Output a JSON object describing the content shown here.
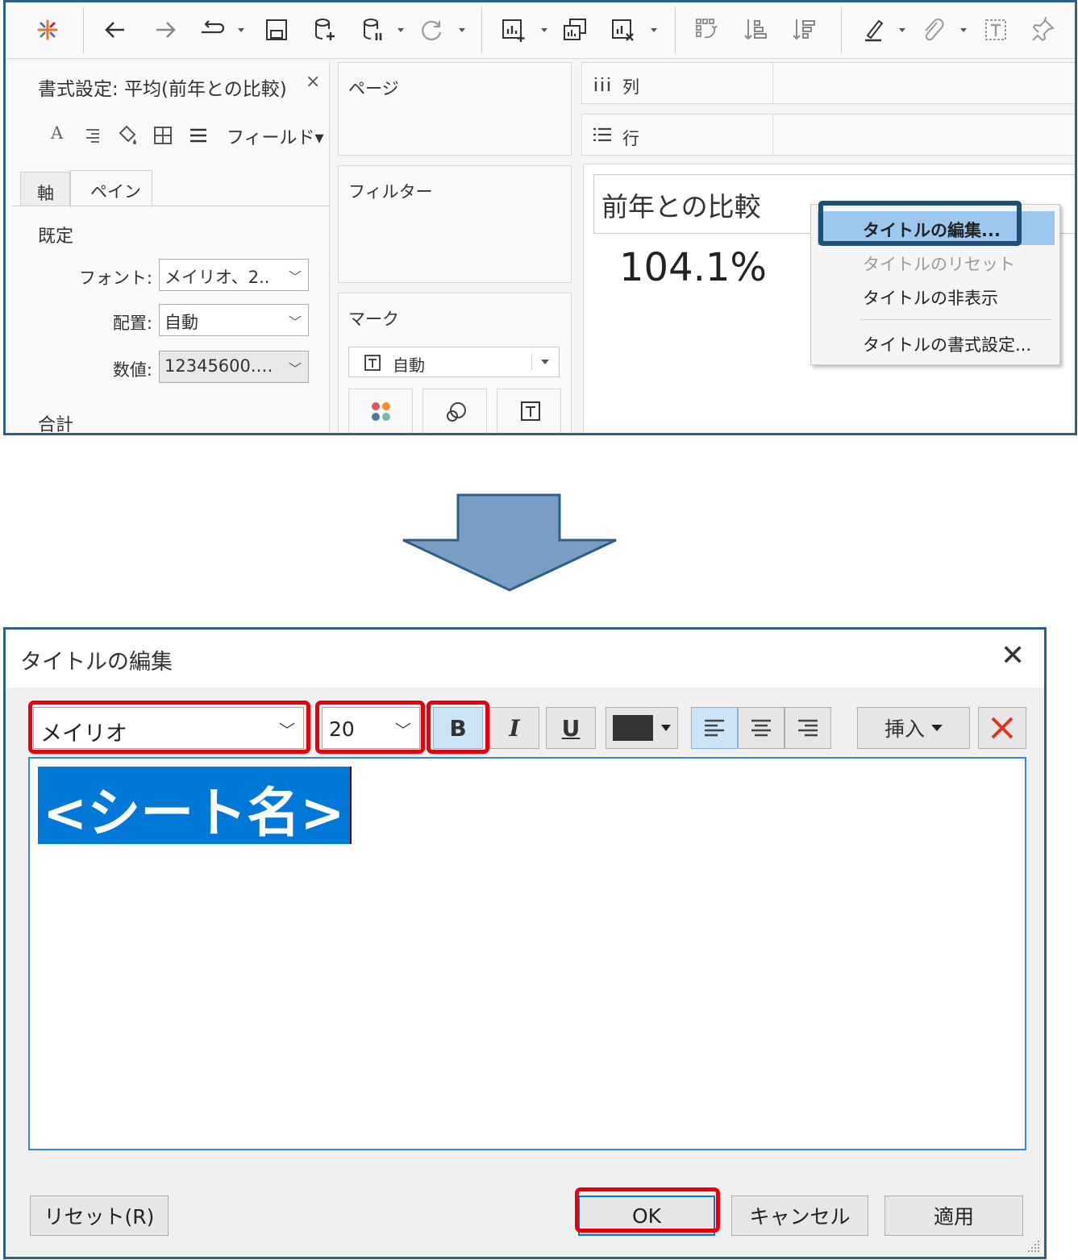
{
  "top": {
    "format_panel": {
      "title": "書式設定: 平均(前年との比較)",
      "close_glyph": "×",
      "field_menu": "フィールド▾",
      "tabs": [
        "軸",
        "ペイン"
      ],
      "section_default": "既定",
      "rows": [
        {
          "label": "フォント:",
          "value": "メイリオ、2.."
        },
        {
          "label": "配置:",
          "value": "自動"
        },
        {
          "label": "数値:",
          "value": "12345600.…"
        }
      ],
      "section_total": "合計"
    },
    "shelves": {
      "pages": "ページ",
      "filters": "フィルター",
      "marks": "マーク",
      "marks_type": "自動",
      "columns": "列",
      "rows": "行"
    },
    "sheet": {
      "title": "前年との比較",
      "value": "104.1%"
    },
    "context_menu": {
      "items": [
        {
          "label": "タイトルの編集...",
          "enabled": true
        },
        {
          "label": "タイトルのリセット",
          "enabled": false
        },
        {
          "label": "タイトルの非表示",
          "enabled": true
        },
        {
          "label": "タイトルの書式設定...",
          "enabled": true
        }
      ]
    },
    "icons": [
      "tableau-logo-icon",
      "undo-icon",
      "redo-icon",
      "replay-icon",
      "save-icon",
      "new-datasource-icon",
      "pause-datasource-icon",
      "refresh-icon",
      "new-worksheet-icon",
      "duplicate-icon",
      "clear-sheet-icon",
      "swap-icon",
      "sort-asc-icon",
      "sort-desc-icon",
      "highlight-icon",
      "paperclip-icon",
      "label-icon",
      "pin-icon"
    ]
  },
  "dialog": {
    "title": "タイトルの編集",
    "close_glyph": "✕",
    "font": "メイリオ",
    "size": "20",
    "bold": "B",
    "italic": "I",
    "underline": "U",
    "insert": "挿入",
    "content": "<シート名>",
    "buttons": {
      "reset": "リセット(R)",
      "ok": "OK",
      "cancel": "キャンセル",
      "apply": "適用"
    }
  },
  "colors": {
    "frame": "#2e5f8a",
    "highlight_red": "#e8000a",
    "highlight_blue": "#1f4e79",
    "selection": "#0078d7",
    "arrow": "#7a9dc4",
    "menu_hover": "#9cc8ef",
    "text_color_swatch": "#333333"
  }
}
